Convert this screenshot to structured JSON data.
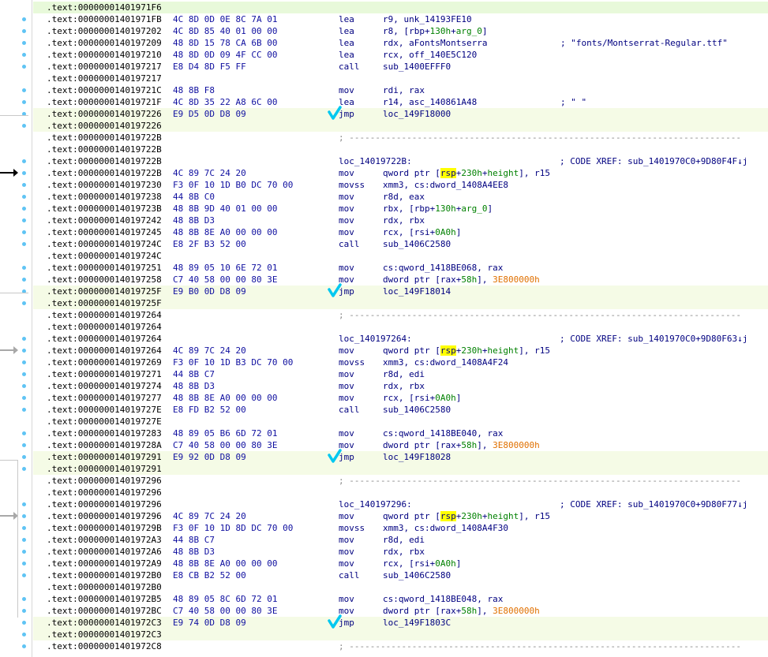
{
  "colors": {
    "address": "#000000",
    "bytes": "#1010a0",
    "code": "#000080",
    "offset": "#008000",
    "constant": "#e07000",
    "rsp_highlight": "#ffff00",
    "row_highlight": "#f5fbe6",
    "checkmark": "#00c8f0",
    "gutter_dot": "#5fc4f4"
  },
  "icons": {
    "checkmark": "handwritten-checkmark-icon",
    "arrow": "arrow-right-icon",
    "breakpoint_dot": "gutter-dot-icon"
  },
  "lines": [
    {
      "addr": ".text:00000001401971F6",
      "hl": "green"
    },
    {
      "addr": ".text:00000001401971FB",
      "bytes": "4C 8D 0D 0E 8C 7A 01",
      "mn": "lea",
      "ops": [
        {
          "t": "r9, unk_14193FE10"
        }
      ]
    },
    {
      "addr": ".text:0000000140197202",
      "bytes": "4C 8D 85 40 01 00 00",
      "mn": "lea",
      "ops": [
        {
          "t": "r8, [rbp+"
        },
        {
          "t": "130h",
          "c": "offset"
        },
        {
          "t": "+"
        },
        {
          "t": "arg_0",
          "c": "offset"
        },
        {
          "t": "]"
        }
      ]
    },
    {
      "addr": ".text:0000000140197209",
      "bytes": "48 8D 15 78 CA 6B 00",
      "mn": "lea",
      "ops": [
        {
          "t": "rdx, aFontsMontserra"
        }
      ],
      "cmt": "; \"fonts/Montserrat-Regular.ttf\""
    },
    {
      "addr": ".text:0000000140197210",
      "bytes": "48 8D 0D 09 4F CC 00",
      "mn": "lea",
      "ops": [
        {
          "t": "rcx, off_140E5C120"
        }
      ]
    },
    {
      "addr": ".text:0000000140197217",
      "bytes": "E8 D4 8D F5 FF",
      "mn": "call",
      "ops": [
        {
          "t": "sub_1400EFFF0"
        }
      ]
    },
    {
      "addr": ".text:0000000140197217"
    },
    {
      "addr": ".text:000000014019721C",
      "bytes": "48 8B F8",
      "mn": "mov",
      "ops": [
        {
          "t": "rdi, rax"
        }
      ]
    },
    {
      "addr": ".text:000000014019721F",
      "bytes": "4C 8D 35 22 A8 6C 00",
      "mn": "lea",
      "ops": [
        {
          "t": "r14, asc_140861A48"
        }
      ],
      "cmt": "; \" \""
    },
    {
      "addr": ".text:0000000140197226",
      "bytes": "E9 D5 0D D8 09",
      "mn": "jmp",
      "ops": [
        {
          "t": "loc_149F18000"
        }
      ],
      "hl": "yes",
      "check": true
    },
    {
      "addr": ".text:0000000140197226",
      "hl": "yes"
    },
    {
      "addr": ".text:000000014019722B",
      "sep": "; ---------------------------------------------------------------------------"
    },
    {
      "addr": ".text:000000014019722B"
    },
    {
      "addr": ".text:000000014019722B",
      "lbl": "loc_14019722B:",
      "xref": "; CODE XREF: sub_1401970C0+9D80F4F↓j"
    },
    {
      "addr": ".text:000000014019722B",
      "bytes": "4C 89 7C 24 20",
      "mn": "mov",
      "ops": [
        {
          "t": "qword ptr ["
        },
        {
          "t": "rsp",
          "c": "rsp"
        },
        {
          "t": "+"
        },
        {
          "t": "230h",
          "c": "offset"
        },
        {
          "t": "+"
        },
        {
          "t": "height",
          "c": "offset"
        },
        {
          "t": "], r15"
        }
      ]
    },
    {
      "addr": ".text:0000000140197230",
      "bytes": "F3 0F 10 1D B0 DC 70 00",
      "mn": "movss",
      "ops": [
        {
          "t": "xmm3, cs:dword_1408A4EE8"
        }
      ]
    },
    {
      "addr": ".text:0000000140197238",
      "bytes": "44 8B C0",
      "mn": "mov",
      "ops": [
        {
          "t": "r8d, eax"
        }
      ]
    },
    {
      "addr": ".text:000000014019723B",
      "bytes": "48 8B 9D 40 01 00 00",
      "mn": "mov",
      "ops": [
        {
          "t": "rbx, [rbp+"
        },
        {
          "t": "130h",
          "c": "offset"
        },
        {
          "t": "+"
        },
        {
          "t": "arg_0",
          "c": "offset"
        },
        {
          "t": "]"
        }
      ]
    },
    {
      "addr": ".text:0000000140197242",
      "bytes": "48 8B D3",
      "mn": "mov",
      "ops": [
        {
          "t": "rdx, rbx"
        }
      ]
    },
    {
      "addr": ".text:0000000140197245",
      "bytes": "48 8B 8E A0 00 00 00",
      "mn": "mov",
      "ops": [
        {
          "t": "rcx, [rsi+"
        },
        {
          "t": "0A0h",
          "c": "offset"
        },
        {
          "t": "]"
        }
      ]
    },
    {
      "addr": ".text:000000014019724C",
      "bytes": "E8 2F B3 52 00",
      "mn": "call",
      "ops": [
        {
          "t": "sub_1406C2580"
        }
      ]
    },
    {
      "addr": ".text:000000014019724C"
    },
    {
      "addr": ".text:0000000140197251",
      "bytes": "48 89 05 10 6E 72 01",
      "mn": "mov",
      "ops": [
        {
          "t": "cs:qword_1418BE068, rax"
        }
      ]
    },
    {
      "addr": ".text:0000000140197258",
      "bytes": "C7 40 58 00 00 80 3E",
      "mn": "mov",
      "ops": [
        {
          "t": "dword ptr [rax+"
        },
        {
          "t": "58h",
          "c": "offset"
        },
        {
          "t": "], "
        },
        {
          "t": "3E800000h",
          "c": "constant"
        }
      ]
    },
    {
      "addr": ".text:000000014019725F",
      "bytes": "E9 B0 0D D8 09",
      "mn": "jmp",
      "ops": [
        {
          "t": "loc_149F18014"
        }
      ],
      "hl": "yes",
      "check": true
    },
    {
      "addr": ".text:000000014019725F",
      "hl": "yes"
    },
    {
      "addr": ".text:0000000140197264",
      "sep": "; ---------------------------------------------------------------------------"
    },
    {
      "addr": ".text:0000000140197264"
    },
    {
      "addr": ".text:0000000140197264",
      "lbl": "loc_140197264:",
      "xref": "; CODE XREF: sub_1401970C0+9D80F63↓j"
    },
    {
      "addr": ".text:0000000140197264",
      "bytes": "4C 89 7C 24 20",
      "mn": "mov",
      "ops": [
        {
          "t": "qword ptr ["
        },
        {
          "t": "rsp",
          "c": "rsp"
        },
        {
          "t": "+"
        },
        {
          "t": "230h",
          "c": "offset"
        },
        {
          "t": "+"
        },
        {
          "t": "height",
          "c": "offset"
        },
        {
          "t": "], r15"
        }
      ]
    },
    {
      "addr": ".text:0000000140197269",
      "bytes": "F3 0F 10 1D B3 DC 70 00",
      "mn": "movss",
      "ops": [
        {
          "t": "xmm3, cs:dword_1408A4F24"
        }
      ]
    },
    {
      "addr": ".text:0000000140197271",
      "bytes": "44 8B C7",
      "mn": "mov",
      "ops": [
        {
          "t": "r8d, edi"
        }
      ]
    },
    {
      "addr": ".text:0000000140197274",
      "bytes": "48 8B D3",
      "mn": "mov",
      "ops": [
        {
          "t": "rdx, rbx"
        }
      ]
    },
    {
      "addr": ".text:0000000140197277",
      "bytes": "48 8B 8E A0 00 00 00",
      "mn": "mov",
      "ops": [
        {
          "t": "rcx, [rsi+"
        },
        {
          "t": "0A0h",
          "c": "offset"
        },
        {
          "t": "]"
        }
      ]
    },
    {
      "addr": ".text:000000014019727E",
      "bytes": "E8 FD B2 52 00",
      "mn": "call",
      "ops": [
        {
          "t": "sub_1406C2580"
        }
      ]
    },
    {
      "addr": ".text:000000014019727E"
    },
    {
      "addr": ".text:0000000140197283",
      "bytes": "48 89 05 B6 6D 72 01",
      "mn": "mov",
      "ops": [
        {
          "t": "cs:qword_1418BE040, rax"
        }
      ]
    },
    {
      "addr": ".text:000000014019728A",
      "bytes": "C7 40 58 00 00 80 3E",
      "mn": "mov",
      "ops": [
        {
          "t": "dword ptr [rax+"
        },
        {
          "t": "58h",
          "c": "offset"
        },
        {
          "t": "], "
        },
        {
          "t": "3E800000h",
          "c": "constant"
        }
      ]
    },
    {
      "addr": ".text:0000000140197291",
      "bytes": "E9 92 0D D8 09",
      "mn": "jmp",
      "ops": [
        {
          "t": "loc_149F18028"
        }
      ],
      "hl": "yes",
      "check": true
    },
    {
      "addr": ".text:0000000140197291",
      "hl": "yes"
    },
    {
      "addr": ".text:0000000140197296",
      "sep": "; ---------------------------------------------------------------------------"
    },
    {
      "addr": ".text:0000000140197296"
    },
    {
      "addr": ".text:0000000140197296",
      "lbl": "loc_140197296:",
      "xref": "; CODE XREF: sub_1401970C0+9D80F77↓j"
    },
    {
      "addr": ".text:0000000140197296",
      "bytes": "4C 89 7C 24 20",
      "mn": "mov",
      "ops": [
        {
          "t": "qword ptr ["
        },
        {
          "t": "rsp",
          "c": "rsp"
        },
        {
          "t": "+"
        },
        {
          "t": "230h",
          "c": "offset"
        },
        {
          "t": "+"
        },
        {
          "t": "height",
          "c": "offset"
        },
        {
          "t": "], r15"
        }
      ]
    },
    {
      "addr": ".text:000000014019729B",
      "bytes": "F3 0F 10 1D 8D DC 70 00",
      "mn": "movss",
      "ops": [
        {
          "t": "xmm3, cs:dword_1408A4F30"
        }
      ]
    },
    {
      "addr": ".text:00000001401972A3",
      "bytes": "44 8B C7",
      "mn": "mov",
      "ops": [
        {
          "t": "r8d, edi"
        }
      ]
    },
    {
      "addr": ".text:00000001401972A6",
      "bytes": "48 8B D3",
      "mn": "mov",
      "ops": [
        {
          "t": "rdx, rbx"
        }
      ]
    },
    {
      "addr": ".text:00000001401972A9",
      "bytes": "48 8B 8E A0 00 00 00",
      "mn": "mov",
      "ops": [
        {
          "t": "rcx, [rsi+"
        },
        {
          "t": "0A0h",
          "c": "offset"
        },
        {
          "t": "]"
        }
      ]
    },
    {
      "addr": ".text:00000001401972B0",
      "bytes": "E8 CB B2 52 00",
      "mn": "call",
      "ops": [
        {
          "t": "sub_1406C2580"
        }
      ]
    },
    {
      "addr": ".text:00000001401972B0"
    },
    {
      "addr": ".text:00000001401972B5",
      "bytes": "48 89 05 8C 6D 72 01",
      "mn": "mov",
      "ops": [
        {
          "t": "cs:qword_1418BE048, rax"
        }
      ]
    },
    {
      "addr": ".text:00000001401972BC",
      "bytes": "C7 40 58 00 00 80 3E",
      "mn": "mov",
      "ops": [
        {
          "t": "dword ptr [rax+"
        },
        {
          "t": "58h",
          "c": "offset"
        },
        {
          "t": "], "
        },
        {
          "t": "3E800000h",
          "c": "constant"
        }
      ]
    },
    {
      "addr": ".text:00000001401972C3",
      "bytes": "E9 74 0D D8 09",
      "mn": "jmp",
      "ops": [
        {
          "t": "loc_149F1803C"
        }
      ],
      "hl": "yes",
      "check": true
    },
    {
      "addr": ".text:00000001401972C3",
      "hl": "yes"
    },
    {
      "addr": ".text:00000001401972C8",
      "sep": "; ---------------------------------------------------------------------------"
    }
  ]
}
